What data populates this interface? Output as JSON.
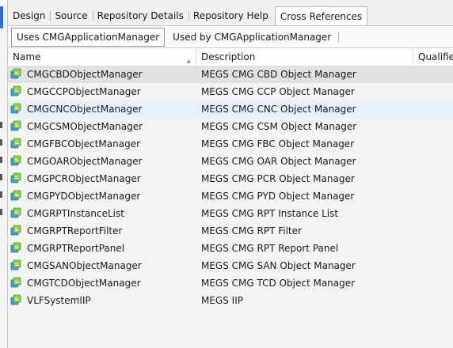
{
  "top_tabs": [
    {
      "label": "Design",
      "active": false
    },
    {
      "label": "Source",
      "active": false
    },
    {
      "label": "Repository Details",
      "active": false
    },
    {
      "label": "Repository Help",
      "active": false
    },
    {
      "label": "Cross References",
      "active": true
    }
  ],
  "sub_tabs": [
    {
      "label": "Uses CMGApplicationManager",
      "active": true
    },
    {
      "label": "Used by CMGApplicationManager",
      "active": false
    }
  ],
  "grid": {
    "columns": {
      "name": "Name",
      "description": "Description",
      "qualifier": "Qualifier"
    },
    "rows": [
      {
        "name": "CMGCBDObjectManager",
        "description": "MEGS CMG CBD Object Manager",
        "icon": "object-component-icon"
      },
      {
        "name": "CMGCCPObjectManager",
        "description": "MEGS CMG CCP Object Manager",
        "icon": "object-component-icon"
      },
      {
        "name": "CMGCNCObjectManager",
        "description": "MEGS CMG CNC Object Manager",
        "icon": "object-component-icon"
      },
      {
        "name": "CMGCSMObjectManager",
        "description": "MEGS CMG CSM Object Manager",
        "icon": "object-component-icon"
      },
      {
        "name": "CMGFBCObjectManager",
        "description": "MEGS CMG FBC Object Manager",
        "icon": "object-component-icon"
      },
      {
        "name": "CMGOARObjectManager",
        "description": "MEGS CMG OAR Object Manager",
        "icon": "object-component-icon"
      },
      {
        "name": "CMGPCRObjectManager",
        "description": "MEGS CMG PCR Object Manager",
        "icon": "object-component-icon"
      },
      {
        "name": "CMGPYDObjectManager",
        "description": "MEGS CMG PYD Object Manager",
        "icon": "object-component-icon"
      },
      {
        "name": "CMGRPTInstanceList",
        "description": "MEGS CMG RPT Instance List",
        "icon": "object-component-icon"
      },
      {
        "name": "CMGRPTReportFilter",
        "description": "MEGS CMG RPT Filter",
        "icon": "object-component-icon"
      },
      {
        "name": "CMGRPTReportPanel",
        "description": "MEGS CMG RPT Report Panel",
        "icon": "object-component-icon"
      },
      {
        "name": "CMGSANObjectManager",
        "description": "MEGS CMG SAN Object Manager",
        "icon": "object-component-icon"
      },
      {
        "name": "CMGTCDObjectManager",
        "description": "MEGS CMG TCD Object Manager",
        "icon": "object-component-icon"
      },
      {
        "name": "VLFSystemIIP",
        "description": "MEGS IIP",
        "icon": "object-component-icon"
      }
    ]
  },
  "colors": {
    "selected_row": "#e1e1e1",
    "hover_row": "#e6f2fb",
    "accent": "#2a6fd1"
  }
}
